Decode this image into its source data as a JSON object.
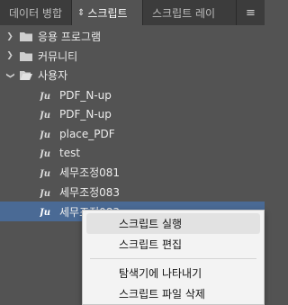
{
  "tabs": {
    "tab1": "데이터 병합",
    "tab2": "스크립트",
    "tab3": "스크립트 레이"
  },
  "tree": {
    "folders": [
      {
        "label": "응용 프로그램",
        "expanded": false
      },
      {
        "label": "커뮤니티",
        "expanded": false
      },
      {
        "label": "사용자",
        "expanded": true
      }
    ],
    "scripts": [
      {
        "label": "PDF_N-up"
      },
      {
        "label": "PDF_N-up"
      },
      {
        "label": "place_PDF"
      },
      {
        "label": "test"
      },
      {
        "label": "세무조정081"
      },
      {
        "label": "세무조정083"
      },
      {
        "label": "세무조정083"
      }
    ]
  },
  "context_menu": {
    "items": [
      {
        "label": "스크립트 실행"
      },
      {
        "label": "스크립트 편집"
      },
      {
        "label": "탐색기에 나타내기"
      },
      {
        "label": "스크립트 파일 삭제"
      }
    ]
  },
  "colors": {
    "panel_bg": "#535353",
    "tabbar_bg": "#3c3c3c",
    "selection": "#4a6a95",
    "menu_bg": "#f3f3f3"
  }
}
